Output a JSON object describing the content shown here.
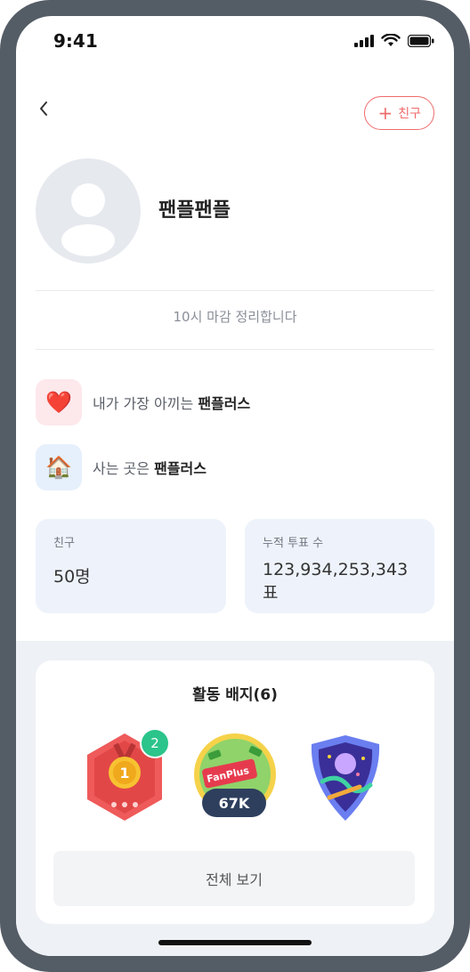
{
  "status_bar": {
    "time": "9:41",
    "icons": [
      "signal-icon",
      "wifi-icon",
      "battery-icon"
    ]
  },
  "header": {
    "back_icon": "chevron-left-icon",
    "add_friend_icon": "plus-icon",
    "add_friend_label": "친구"
  },
  "profile": {
    "nickname": "팬플팬플",
    "bio": "10시 마감 정리합니다",
    "avatar_icon": "user-silhouette-icon"
  },
  "info": [
    {
      "icon": "heart-icon",
      "glyph": "❤️",
      "prefix": "내가 가장 아끼는 ",
      "value": "팬플러스"
    },
    {
      "icon": "house-icon",
      "glyph": "🏠",
      "prefix": "사는 곳은 ",
      "value": "팬플러스"
    }
  ],
  "stats": {
    "friends": {
      "label": "친구",
      "value": "50명"
    },
    "votes": {
      "label": "누적 투표 수",
      "value": "123,934,253,343 표"
    }
  },
  "badges": {
    "title": "활동 배지(6)",
    "items": [
      {
        "icon": "first-place-medal-icon",
        "count": "2"
      },
      {
        "icon": "fanplus-ticket-icon",
        "text": "FanPlus",
        "votes": "67K"
      },
      {
        "icon": "party-shield-icon"
      }
    ],
    "view_all_label": "전체 보기"
  },
  "colors": {
    "accent": "#f06b6b",
    "card_bg": "#eef3fb",
    "badge_count": "#2bc48a",
    "votes_pill": "#2e3f5e"
  }
}
